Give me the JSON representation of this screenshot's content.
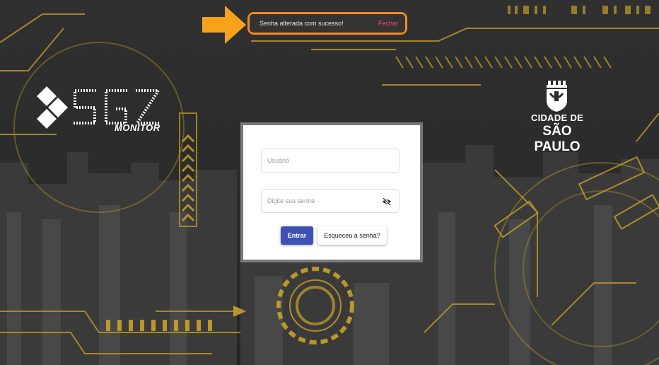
{
  "snackbar": {
    "message": "Senha alterada com sucesso!",
    "action": "Fechar"
  },
  "brand": {
    "product_suffix": "MONITOR"
  },
  "city_logo": {
    "line1": "CIDADE DE",
    "line2": "SÃO PAULO"
  },
  "login": {
    "username_placeholder": "Usuário",
    "password_placeholder": "Digite sua senha",
    "submit_label": "Entrar",
    "forgot_label": "Esqueceu a senha?"
  },
  "colors": {
    "accent": "#f28c1f",
    "primary_button": "#3f51b5",
    "snackbar_action": "#ff4081",
    "circuit_gold": "#c9a227"
  }
}
